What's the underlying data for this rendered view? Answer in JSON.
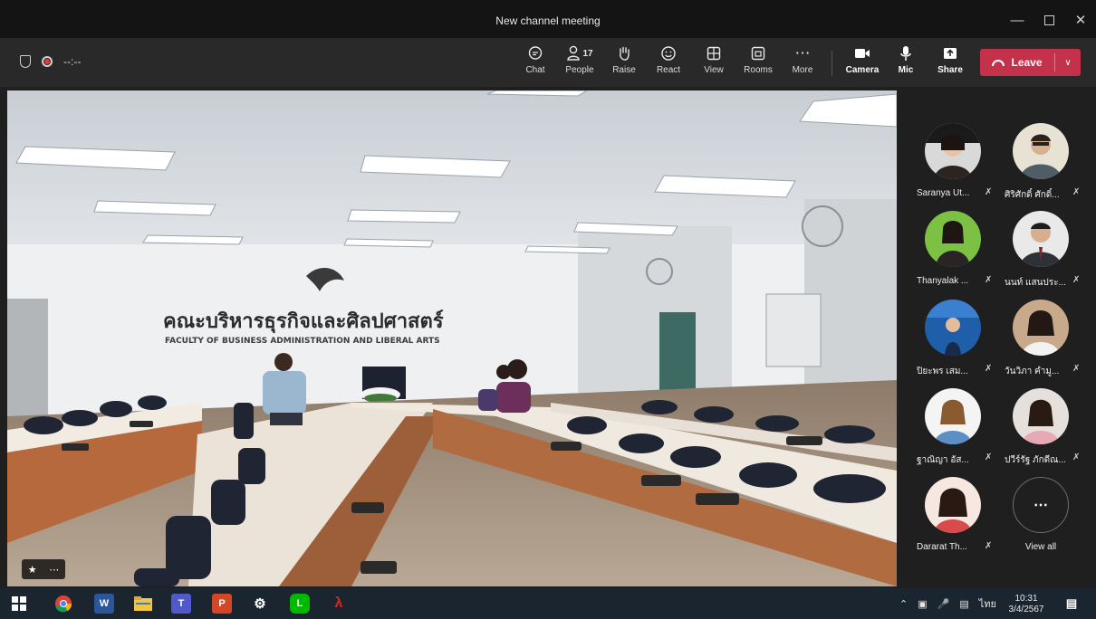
{
  "window": {
    "title": "New channel meeting"
  },
  "toolbar": {
    "timer": "--:--",
    "buttons": [
      {
        "label": "Chat",
        "icon": "chat-icon"
      },
      {
        "label": "People",
        "icon": "people-icon",
        "count": "17"
      },
      {
        "label": "Raise",
        "icon": "raise-hand-icon"
      },
      {
        "label": "React",
        "icon": "smiley-icon"
      },
      {
        "label": "View",
        "icon": "grid-icon"
      },
      {
        "label": "Rooms",
        "icon": "rooms-icon"
      },
      {
        "label": "More",
        "icon": "ellipsis-icon"
      }
    ],
    "camera_label": "Camera",
    "mic_label": "Mic",
    "share_label": "Share",
    "leave_label": "Leave"
  },
  "participants": [
    {
      "name": "Saranya Ut...",
      "muted": true
    },
    {
      "name": "ศิริศักดิ์ ศักดิ์...",
      "muted": true
    },
    {
      "name": "Thanyalak ...",
      "muted": true
    },
    {
      "name": "นนท์ แสนประ...",
      "muted": true
    },
    {
      "name": "ปิยะพร เสม...",
      "muted": true
    },
    {
      "name": "วันวิภา คำมู...",
      "muted": true
    },
    {
      "name": "ฐาณิญา อัส...",
      "muted": true
    },
    {
      "name": "ปวีร์รัฐ ภักดีณ...",
      "muted": true
    },
    {
      "name": "Dararat Th...",
      "muted": true
    }
  ],
  "view_all_label": "View all",
  "video": {
    "sign_thai": "คณะบริหารธุรกิจและศิลปศาสตร์",
    "sign_english": "FACULTY OF BUSINESS ADMINISTRATION AND LIBERAL ARTS"
  },
  "taskbar": {
    "language": "ไทย",
    "time": "10:31",
    "date": "3/4/2567"
  },
  "colors": {
    "leave": "#c4314b",
    "toolbar": "#292929",
    "taskbar": "#1b2530"
  }
}
